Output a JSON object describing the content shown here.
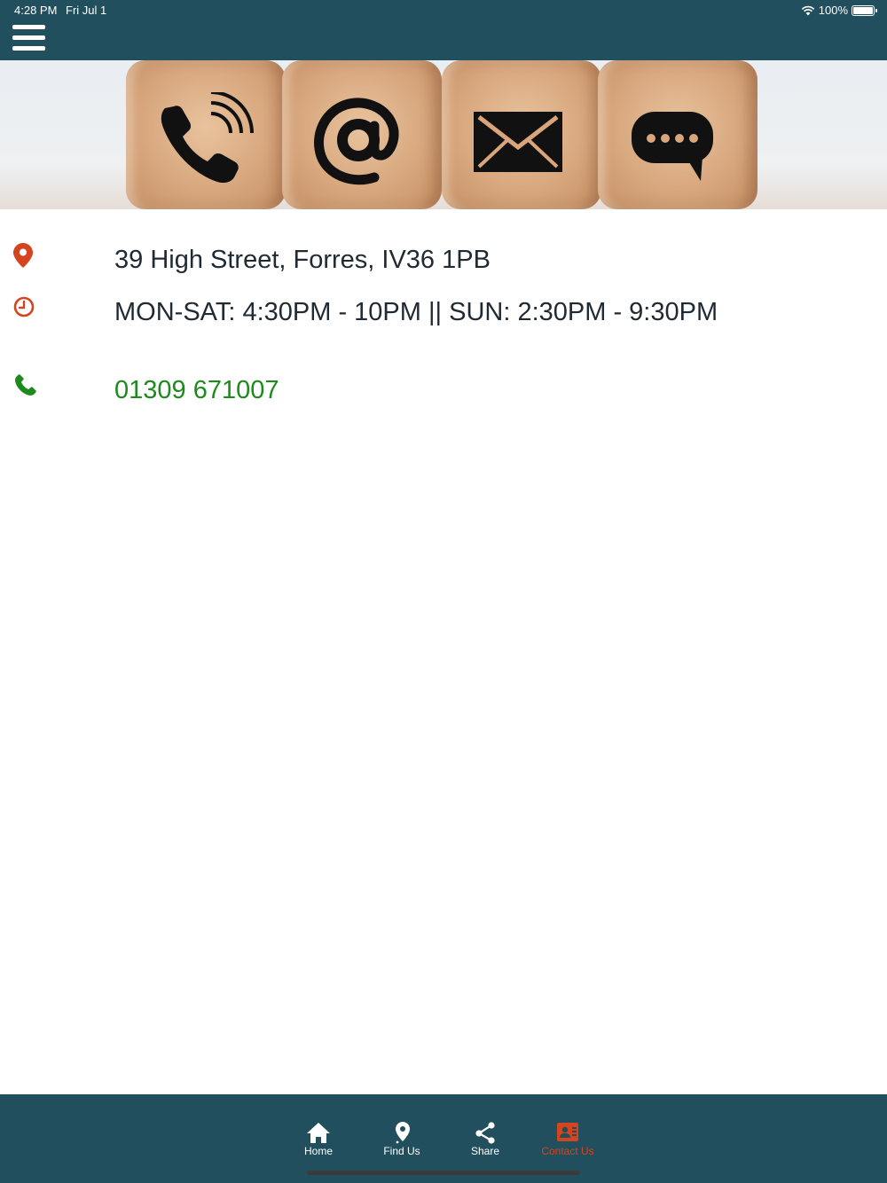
{
  "status_bar": {
    "time": "4:28 PM",
    "date": "Fri Jul 1",
    "battery": "100%",
    "battery_level": 1.0,
    "wifi_icon": "wifi-icon"
  },
  "header": {
    "menu_icon": "hamburger-menu-icon"
  },
  "banner": {
    "icons": [
      "phone-icon",
      "at-sign-icon",
      "envelope-icon",
      "chat-bubble-icon"
    ]
  },
  "contact": {
    "address": "39 High Street, Forres, IV36 1PB",
    "hours": "MON-SAT: 4:30PM - 10PM || SUN: 2:30PM - 9:30PM",
    "phone": "01309 671007"
  },
  "tabs": [
    {
      "label": "Home",
      "icon": "home-icon",
      "active": false
    },
    {
      "label": "Find Us",
      "icon": "map-pin-icon",
      "active": false
    },
    {
      "label": "Share",
      "icon": "share-icon",
      "active": false
    },
    {
      "label": "Contact Us",
      "icon": "contact-card-icon",
      "active": true
    }
  ],
  "colors": {
    "header_bg": "#214f5e",
    "accent": "#d2451e",
    "phone_green": "#1e8a1e",
    "text": "#1f2a33"
  }
}
